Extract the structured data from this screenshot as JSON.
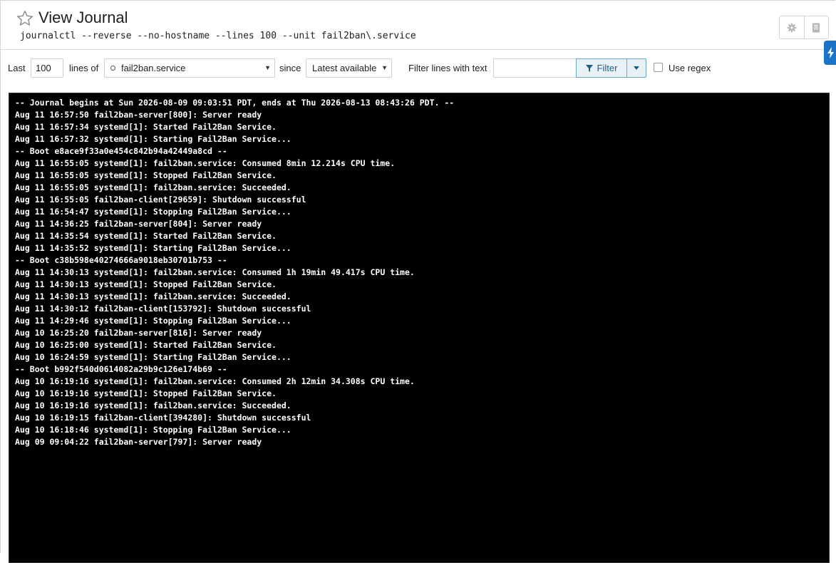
{
  "header": {
    "title": "View Journal",
    "command": "journalctl --reverse --no-hostname --lines 100 --unit fail2ban\\.service"
  },
  "icons": {
    "favorite": "star-outline-icon",
    "settings": "gear-icon",
    "manual": "book-icon",
    "side_tab": "lightning-icon"
  },
  "toolbar": {
    "last_label": "Last",
    "lines_value": "100",
    "lines_of_label": "lines of",
    "unit_value": "fail2ban.service",
    "since_label": "since",
    "since_value": "Latest available",
    "filter_label": "Filter lines with text",
    "filter_value": "",
    "filter_button": "Filter",
    "regex_label": "Use regex",
    "regex_checked": false
  },
  "colors": {
    "filter_accent": "#1d5f82",
    "side_tab": "#1a73c8",
    "journal_bg": "#000000",
    "journal_text": "#ffffff"
  },
  "journal": {
    "lines": [
      "-- Journal begins at Sun 2026-08-09 09:03:51 PDT, ends at Thu 2026-08-13 08:43:26 PDT. --",
      "Aug 11 16:57:50 fail2ban-server[800]: Server ready",
      "Aug 11 16:57:34 systemd[1]: Started Fail2Ban Service.",
      "Aug 11 16:57:32 systemd[1]: Starting Fail2Ban Service...",
      "-- Boot e8ace9f33a0e454c842b94a42449a8cd --",
      "Aug 11 16:55:05 systemd[1]: fail2ban.service: Consumed 8min 12.214s CPU time.",
      "Aug 11 16:55:05 systemd[1]: Stopped Fail2Ban Service.",
      "Aug 11 16:55:05 systemd[1]: fail2ban.service: Succeeded.",
      "Aug 11 16:55:05 fail2ban-client[29659]: Shutdown successful",
      "Aug 11 16:54:47 systemd[1]: Stopping Fail2Ban Service...",
      "Aug 11 14:36:25 fail2ban-server[804]: Server ready",
      "Aug 11 14:35:54 systemd[1]: Started Fail2Ban Service.",
      "Aug 11 14:35:52 systemd[1]: Starting Fail2Ban Service...",
      "-- Boot c38b598e40274666a9018eb30701b753 --",
      "Aug 11 14:30:13 systemd[1]: fail2ban.service: Consumed 1h 19min 49.417s CPU time.",
      "Aug 11 14:30:13 systemd[1]: Stopped Fail2Ban Service.",
      "Aug 11 14:30:13 systemd[1]: fail2ban.service: Succeeded.",
      "Aug 11 14:30:12 fail2ban-client[153792]: Shutdown successful",
      "Aug 11 14:29:46 systemd[1]: Stopping Fail2Ban Service...",
      "Aug 10 16:25:20 fail2ban-server[816]: Server ready",
      "Aug 10 16:25:00 systemd[1]: Started Fail2Ban Service.",
      "Aug 10 16:24:59 systemd[1]: Starting Fail2Ban Service...",
      "-- Boot b992f540d0614082a29b9c126e174b69 --",
      "Aug 10 16:19:16 systemd[1]: fail2ban.service: Consumed 2h 12min 34.308s CPU time.",
      "Aug 10 16:19:16 systemd[1]: Stopped Fail2Ban Service.",
      "Aug 10 16:19:16 systemd[1]: fail2ban.service: Succeeded.",
      "Aug 10 16:19:15 fail2ban-client[394280]: Shutdown successful",
      "Aug 10 16:18:46 systemd[1]: Stopping Fail2Ban Service...",
      "Aug 09 09:04:22 fail2ban-server[797]: Server ready"
    ]
  }
}
